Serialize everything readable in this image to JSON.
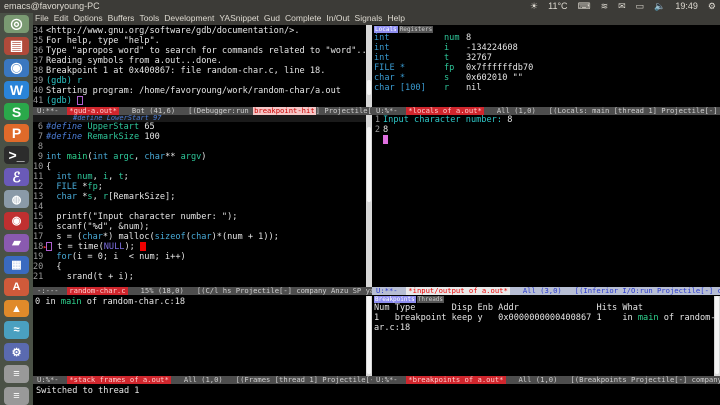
{
  "window_title": "emacs@favoryoung-PC",
  "tray": {
    "weather": "11°C",
    "time": "19:49"
  },
  "menu": [
    "File",
    "Edit",
    "Options",
    "Buffers",
    "Tools",
    "Development",
    "YASnippet",
    "Gud",
    "Complete",
    "In/Out",
    "Signals",
    "Help"
  ],
  "launcher": [
    {
      "icon": "ubuntu-icon",
      "color": "#7a9a72",
      "g": "◎"
    },
    {
      "icon": "files-icon",
      "color": "#b04a3a",
      "g": "▤"
    },
    {
      "icon": "chromium-icon",
      "color": "#3a77c0",
      "g": "◉"
    },
    {
      "icon": "wps-writer-icon",
      "color": "#2a84d8",
      "g": "W"
    },
    {
      "icon": "wps-spreadsheets-icon",
      "color": "#2aa84a",
      "g": "S"
    },
    {
      "icon": "wps-presentation-icon",
      "color": "#e06a2a",
      "g": "P"
    },
    {
      "icon": "terminal-icon",
      "color": "#2c2c2c",
      "g": ">_"
    },
    {
      "icon": "emacs-icon",
      "color": "#6a5ab8",
      "g": "ℰ"
    },
    {
      "icon": "app-icon",
      "color": "#8a9aa8",
      "g": "◍"
    },
    {
      "icon": "app-icon",
      "color": "#c03030",
      "g": "◉"
    },
    {
      "icon": "app-icon",
      "color": "#8a5ab0",
      "g": "▰"
    },
    {
      "icon": "calculator-icon",
      "color": "#3a6ac0",
      "g": "▦"
    },
    {
      "icon": "app-icon",
      "color": "#d05a3a",
      "g": "A"
    },
    {
      "icon": "app-icon",
      "color": "#e08a2a",
      "g": "▲"
    },
    {
      "icon": "app-icon",
      "color": "#4aa0c0",
      "g": "≈"
    },
    {
      "icon": "app-icon",
      "color": "#5a6ab0",
      "g": "⚙"
    },
    {
      "icon": "app-icon",
      "color": "#999",
      "g": "≡"
    },
    {
      "icon": "app-icon",
      "color": "#999",
      "g": "≡"
    }
  ],
  "gdb": {
    "lines": [
      [
        "34",
        "<http://www.gnu.org/software/gdb/documentation/>."
      ],
      [
        "35",
        "For help, type \"help\"."
      ],
      [
        "36",
        "Type \"apropos word\" to search for commands related to \"word\"..."
      ],
      [
        "37",
        "Reading symbols from a.out...done."
      ],
      [
        "38",
        "Breakpoint 1 at 0x400867: file random-char.c, line 18."
      ],
      [
        "39",
        "(gdb) r"
      ],
      [
        "40",
        "Starting program: /home/favoryoung/work/random-char/a.out"
      ],
      [
        "41",
        "(gdb) "
      ]
    ],
    "modeline": {
      "state": "U:**-",
      "buffer": "*gud-a.out*",
      "pos": "Bot (41,6)",
      "modes_pre": "[(Debugger:run ",
      "hit": "breakpoint-hit",
      "modes_post": "] Projectile[-] company Anzu"
    }
  },
  "source": {
    "header": "#define LowerStart 97",
    "lines": [
      [
        "6",
        [
          [
            "pp",
            "#define "
          ],
          [
            "var",
            "UpperStart"
          ],
          [
            "nm",
            " 65"
          ]
        ]
      ],
      [
        "7",
        [
          [
            "pp",
            "#define "
          ],
          [
            "var",
            "RemarkSize"
          ],
          [
            "nm",
            " 100"
          ]
        ]
      ],
      [
        "8",
        []
      ],
      [
        "9",
        [
          [
            "kw",
            "int "
          ],
          [
            "fn",
            "main"
          ],
          [
            "nm",
            "("
          ],
          [
            "kw",
            "int "
          ],
          [
            "var",
            "argc"
          ],
          [
            "nm",
            ", "
          ],
          [
            "kw",
            "char"
          ],
          [
            "nm",
            "** "
          ],
          [
            "var",
            "argv"
          ],
          [
            "nm",
            ")"
          ]
        ]
      ],
      [
        "10",
        [
          [
            "nm",
            "{"
          ]
        ]
      ],
      [
        "11",
        [
          [
            "kw",
            "  int "
          ],
          [
            "var",
            "num"
          ],
          [
            "nm",
            ", "
          ],
          [
            "var",
            "i"
          ],
          [
            "nm",
            ", "
          ],
          [
            "var",
            "t"
          ],
          [
            "nm",
            ";"
          ]
        ]
      ],
      [
        "12",
        [
          [
            "kw",
            "  FILE "
          ],
          [
            "nm",
            "*"
          ],
          [
            "var",
            "fp"
          ],
          [
            "nm",
            ";"
          ]
        ]
      ],
      [
        "13",
        [
          [
            "kw",
            "  char "
          ],
          [
            "nm",
            "*"
          ],
          [
            "var",
            "s"
          ],
          [
            "nm",
            ", "
          ],
          [
            "var",
            "r"
          ],
          [
            "nm",
            "[RemarkSize];"
          ]
        ]
      ],
      [
        "14",
        []
      ],
      [
        "15",
        [
          [
            "nm",
            "  printf(\"Input character number: \");"
          ]
        ]
      ],
      [
        "16",
        [
          [
            "nm",
            "  scanf(\"%d\", &num);"
          ]
        ]
      ],
      [
        "17",
        [
          [
            "nm",
            "  s = ("
          ],
          [
            "kw",
            "char"
          ],
          [
            "nm",
            "*) malloc("
          ],
          [
            "kw",
            "sizeof"
          ],
          [
            "nm",
            "("
          ],
          [
            "kw",
            "char"
          ],
          [
            "nm",
            ")*(num + 1));"
          ]
        ]
      ],
      [
        "18",
        [
          [
            "nm",
            " t = time("
          ],
          [
            "cst",
            "NULL"
          ],
          [
            "nm",
            ");"
          ]
        ]
      ],
      [
        "19",
        [
          [
            "kw",
            "  for"
          ],
          [
            "nm",
            "(i = 0; i  < num; i++)"
          ]
        ]
      ],
      [
        "20",
        [
          [
            "nm",
            "  {"
          ]
        ]
      ],
      [
        "21",
        [
          [
            "nm",
            "    srand(t + i);"
          ]
        ]
      ]
    ],
    "modeline": {
      "state": "-:---",
      "buffer": "random-char.c",
      "pos": "15% (18,0)",
      "modes": "[(C/l hs Projectile[-] company Anzu SP yas Undo-Tree wb"
    }
  },
  "locals": {
    "tabs": [
      "Locals",
      "Registers"
    ],
    "rows": [
      [
        "int",
        "num",
        "8"
      ],
      [
        "int",
        "i",
        "-134224608"
      ],
      [
        "int",
        "t",
        "32767"
      ],
      [
        "FILE *",
        "fp",
        "0x7ffffffdb70"
      ],
      [
        "char *",
        "s",
        "0x602010 \"\""
      ],
      [
        "char [100]",
        "r",
        "nil"
      ]
    ],
    "modeline": {
      "state": "U:%*-",
      "buffer": "*locals of a.out*",
      "pos": "All (1,0)",
      "modes": "[(Locals: main [thread 1] Projectile[-] company Anzu"
    }
  },
  "io": {
    "lines": [
      [
        "1",
        "Input character number: ",
        "8"
      ],
      [
        "2",
        "8",
        ""
      ]
    ],
    "modeline": {
      "state": "U:**-",
      "buffer": "*input/output of a.out*",
      "pos": "All (3,0)",
      "modes": "[(Inferior I/O:run Projectile[-] company"
    }
  },
  "frames": {
    "line": {
      "num": "0",
      "pre": " in ",
      "fn": "main",
      "post": " of random-char.c:18"
    },
    "modeline": {
      "state": "U:%*-",
      "buffer": "*stack frames of a.out*",
      "pos": "All (1,0)",
      "modes": "[(Frames [thread 1] Projectile[-] company Anzu"
    }
  },
  "breakpoints": {
    "tabs": [
      "Breakpoints",
      "Threads"
    ],
    "header": "Num Type       Disp Enb Addr               Hits What",
    "row_pre": "1   breakpoint keep y   0x0000000000400867 1    in ",
    "row_fn": "main",
    "row_post": " of random-ch",
    "wrap": "ar.c:18",
    "modeline": {
      "state": "U:%*-",
      "buffer": "*breakpoints of a.out*",
      "pos": "All (1,0)",
      "modes": "[(Breakpoints Projectile[-] company Anzu SP yas"
    }
  },
  "minibuffer": "Switched to thread 1"
}
